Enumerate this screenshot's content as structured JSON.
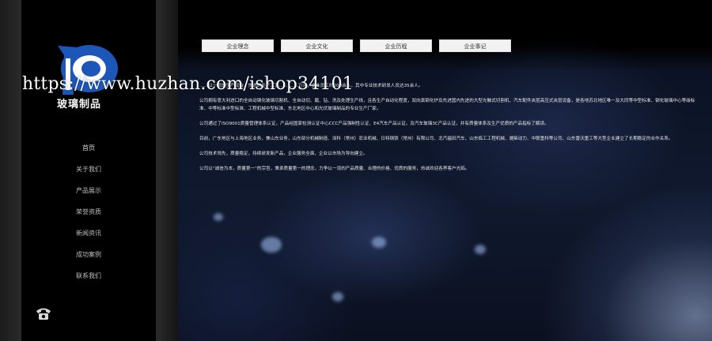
{
  "brand": {
    "logo_text": "玻璃制品"
  },
  "tabs": [
    "企业理念",
    "企业文化",
    "企业历程",
    "企业事记"
  ],
  "nav": [
    "首页",
    "关于我们",
    "产品展示",
    "荣誉资质",
    "新闻资讯",
    "成功案例",
    "联系我们"
  ],
  "content": {
    "paragraphs": [
      "……以一流的生产设备，先进的生产工艺…… ……万元，企业员工约200余人，其中专业技术研发人员达35余人。",
      "公司拥有意大利进口的全自动钢化玻璃切割机、全自动切、磨、钻、洗及处理生产线，且各生产自动化程度，双向真钢化炉及先进国内先进的大型光触式切割机、汽车配件夹层高压式夹层设备，是各地苏北地区唯一及大同等中型标准、钢化玻璃中心等级标准、中等标准中型标准、工程机械中型标准、东北地区中心和光伏玻璃制品的专业生产厂家。",
      "公司通过了ISO9001质量管理体系认证，产品经国家检测认证中心CCC产品强制性认证、E4汽车产品认证，及汽车玻璃3C产品认证，并有质量体系及生产优质的产品指标了解读。",
      "目前，广东地区与上海地区业务，兼山东业务，山东部分机械制造、泽科（常州）农业机械、日特钢铁（常州）有限公司、北汽福田汽车、山东临工工程机械、潍柴动力、中联重科等公司、山东雷沃重工等大型企业建立了长期稳定的合作关系。",
      "公司技术领先，质量稳定，持续研发新产品，企业服务全面，企业以市场为导向建立。",
      "公司以“诚信为本，质量第一”的宗旨，秉承质量第一的理念，力争以一流的产品质量、合理的价格、优质的服务，热诚欢迎各界客户光临。"
    ]
  },
  "watermark": "https://www.huzhan.com/ishop34101",
  "icons": {
    "logo": "logo-d-emblem-icon",
    "phone": "phone-icon"
  },
  "colors": {
    "logo_blue": "#1c56b8",
    "sidebar_bg": "#000000",
    "tab_bg": "#f2f2f2"
  }
}
